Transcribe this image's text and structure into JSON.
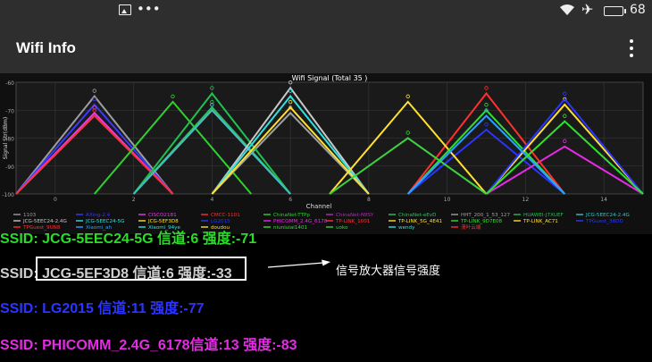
{
  "statusbar": {
    "more": "•••",
    "battery_level": "68"
  },
  "appbar": {
    "title": "Wifi Info"
  },
  "chart_data": {
    "type": "line",
    "title": "Wifi Signal (Total 35 )",
    "xlabel": "Channel",
    "ylabel": "Signal Str(dBm)",
    "xlim": [
      -1,
      15
    ],
    "ylim": [
      -100,
      -60
    ],
    "y_ticks": [
      -60,
      -70,
      -80,
      -90,
      -100
    ],
    "x_ticks": [
      0,
      2,
      4,
      6,
      8,
      10,
      12,
      14
    ],
    "grid": true,
    "legend_placement": "bottom",
    "series": [
      {
        "name": "1103",
        "channel": 1,
        "peak": -65,
        "color": "#9e9e9e"
      },
      {
        "name": "AXing-2.4",
        "channel": 1,
        "peak": -68,
        "color": "#3a3aff"
      },
      {
        "name": "CISCO2181",
        "channel": 1,
        "peak": -71,
        "color": "#e040e0"
      },
      {
        "name": "CMCC-1101",
        "channel": 1,
        "peak": -72,
        "color": "#ff3030"
      },
      {
        "name": "ChinaNet-TTPp",
        "channel": 3,
        "peak": -67,
        "color": "#30d030"
      },
      {
        "name": "ChinaNet-fWSY",
        "channel": 4,
        "peak": -70,
        "color": "#b030b0"
      },
      {
        "name": "ChinaNet-eEvD",
        "channel": 4,
        "peak": -69,
        "color": "#30c060"
      },
      {
        "name": "HHT_200_1_53_127",
        "channel": 6,
        "peak": -71,
        "color": "#a0a0a0"
      },
      {
        "name": "HUAWEI-J7XUEF",
        "channel": 4,
        "peak": -64,
        "color": "#20c050"
      },
      {
        "name": "JCG-5EEC24-2.4G",
        "channel": 4,
        "peak": -70,
        "color": "#40c0c0"
      },
      {
        "name": "JCG-5EEC24-2.4G",
        "channel": 6,
        "peak": -62,
        "color": "#c8c8c8"
      },
      {
        "name": "JCG-5EEC24-5G",
        "channel": 6,
        "peak": -65,
        "color": "#30e0e0"
      },
      {
        "name": "JCG-5EF3D8",
        "channel": 6,
        "peak": -69,
        "color": "#ffe030"
      },
      {
        "name": "LG2015",
        "channel": 11,
        "peak": -77,
        "color": "#2b35ff"
      },
      {
        "name": "PHICOMM_2.4G_6178",
        "channel": 13,
        "peak": -83,
        "color": "#e62be6"
      },
      {
        "name": "TP-LINK_1001",
        "channel": 11,
        "peak": -64,
        "color": "#ff3030"
      },
      {
        "name": "TP-LINK_5G_4E41",
        "channel": 9,
        "peak": -67,
        "color": "#ffe030"
      },
      {
        "name": "TP-LINK_9D7E08",
        "channel": 11,
        "peak": -70,
        "color": "#30e030"
      },
      {
        "name": "TP-LINK_AC71",
        "channel": 13,
        "peak": -68,
        "color": "#ffe030"
      },
      {
        "name": "TPGuest_38DD",
        "channel": 13,
        "peak": -66,
        "color": "#2b35ff"
      },
      {
        "name": "Xiaomi_ah",
        "channel": 11,
        "peak": -72,
        "color": "#30a0ff"
      },
      {
        "name": "uoko",
        "channel": 9,
        "peak": -80,
        "color": "#40d040"
      },
      {
        "name": "wendy",
        "channel": 13,
        "peak": -74,
        "color": "#30e030"
      }
    ],
    "legend": [
      {
        "label": "1103",
        "color": "#9e9e9e"
      },
      {
        "label": "AXing-2.4",
        "color": "#3a3aff"
      },
      {
        "label": "CISCO2181",
        "color": "#e040e0"
      },
      {
        "label": "CMCC-1101",
        "color": "#ff3030"
      },
      {
        "label": "ChinaNet-TTPp",
        "color": "#30d030"
      },
      {
        "label": "ChinaNet-fWSY",
        "color": "#b030b0"
      },
      {
        "label": "ChinaNet-eEvD",
        "color": "#30c060"
      },
      {
        "label": "HHT_200_1_53_127",
        "color": "#a0a0a0"
      },
      {
        "label": "HUAWEI-J7XUEF",
        "color": "#20c050"
      },
      {
        "label": "JCG-5EEC24-2.4G",
        "color": "#40c0c0"
      },
      {
        "label": "JCG-5EEC24-2.4G",
        "color": "#c8c8c8"
      },
      {
        "label": "JCG-5EEC24-5G",
        "color": "#30e0e0"
      },
      {
        "label": "JCG-5EF3D8",
        "color": "#ffe030"
      },
      {
        "label": "LG2015",
        "color": "#2b35ff"
      },
      {
        "label": "PHICOMM_2.4G_6178",
        "color": "#e62be6"
      },
      {
        "label": "TP-LINK_1001",
        "color": "#ff3030"
      },
      {
        "label": "TP-LINK_5G_4E41",
        "color": "#ffe030"
      },
      {
        "label": "TP-LINK_9D7E08",
        "color": "#30e030"
      },
      {
        "label": "TP-LINK_AC71",
        "color": "#ffe030"
      },
      {
        "label": "TPGuest_38DD",
        "color": "#2b35ff"
      },
      {
        "label": "TPGuest_9UN8",
        "color": "#ff3030"
      },
      {
        "label": "Xiaomi_ah",
        "color": "#30a0ff"
      },
      {
        "label": "Xiaomi_94ye",
        "color": "#30e0e0"
      },
      {
        "label": "doudou",
        "color": "#ffe030"
      },
      {
        "label": "niuniuiai1401",
        "color": "#30e030"
      },
      {
        "label": "uoko",
        "color": "#40d040"
      },
      {
        "label": "wendy",
        "color": "#30e0e0"
      },
      {
        "label": "漫叶云端",
        "color": "#ff3030"
      }
    ]
  },
  "rows": {
    "row1": "SSID: JCG-5EEC24-5G  信道:6  强度:-71",
    "row2": "SSID: JCG-5EF3D8 信道:6  强度:-33",
    "row3": "SSID: LG2015  信道:11  强度:-77",
    "row4": "SSID: PHICOMM_2.4G_6178信道:13  强度:-83"
  },
  "annotation": {
    "note": "信号放大器信号强度"
  }
}
